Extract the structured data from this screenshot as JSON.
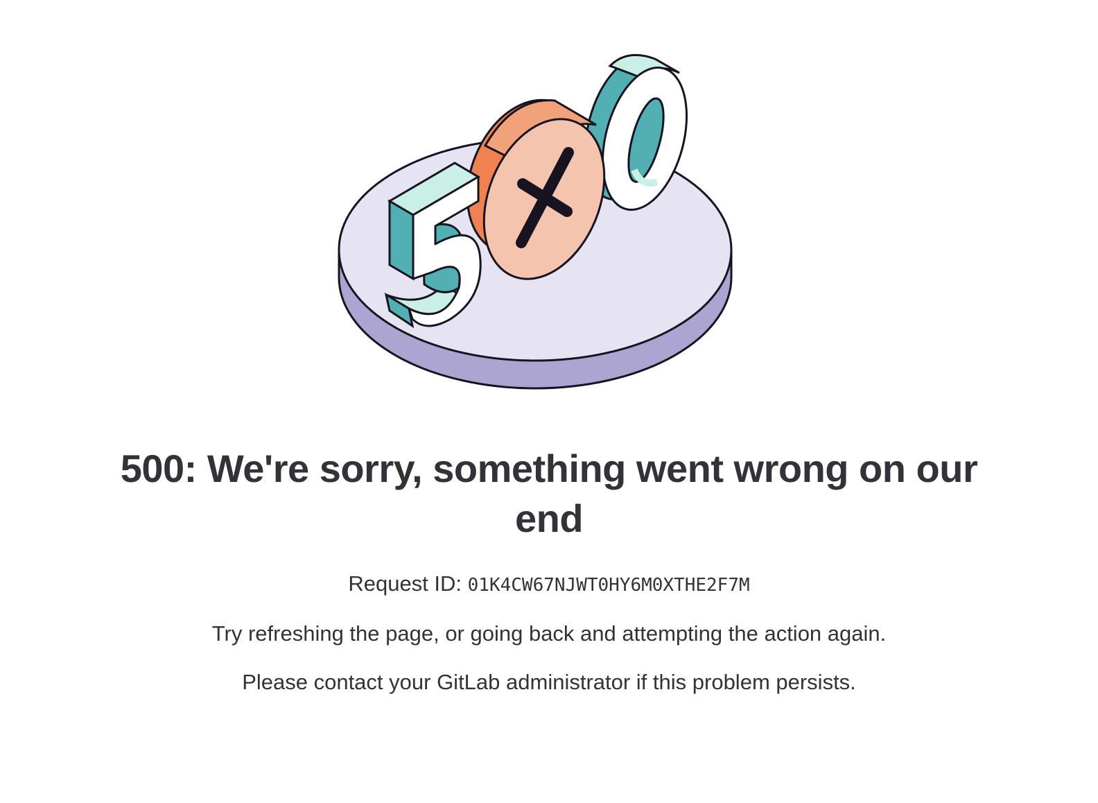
{
  "illustration": {
    "icon": "error-500-illustration",
    "colors": {
      "platform_top": "#e6e4f2",
      "platform_side": "#aca5d2",
      "teal_dark": "#52b0b2",
      "teal_light": "#c9efe6",
      "orange_dark": "#ef8152",
      "orange_mid": "#f2a27a",
      "orange_light": "#f5c4ae",
      "outline": "#171321"
    }
  },
  "error": {
    "title": "500: We're sorry, something went wrong on our end",
    "request_label": "Request ID:",
    "request_id": "01K4CW67NJWT0HY6M0XTHE2F7M",
    "retry_message": "Try refreshing the page, or going back and attempting the action again.",
    "contact_message": "Please contact your GitLab administrator if this problem persists."
  }
}
